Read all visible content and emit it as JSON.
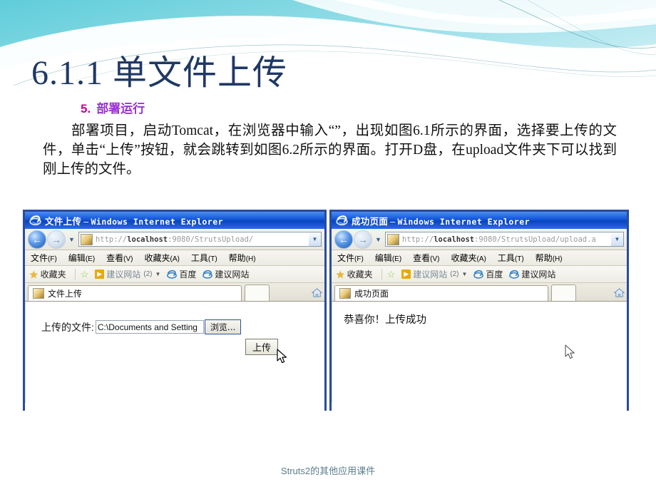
{
  "slide": {
    "title": "6.1.1  单文件上传",
    "sub_heading_number": "5.",
    "sub_heading_text": "部署运行",
    "body_paragraph": "部署项目，启动Tomcat，在浏览器中输入“”，出现如图6.1所示的界面，选择要上传的文件，单击“上传”按钮，就会跳转到如图6.2所示的界面。打开D盘，在upload文件夹下可以找到刚上传的文件。",
    "footer": "Struts2的其他应用课件"
  },
  "theme": {
    "banner_top_color": "#7fd7e0",
    "banner_bottom_color": "#bfe9f2",
    "title_color": "#1f3864",
    "heading_number_color": "#cc0099",
    "heading_text_color": "#9933cc",
    "footer_color": "#5b7d8a",
    "window_border_color": "#2a4c9b",
    "titlebar_color": "#1255d8"
  },
  "browser_left": {
    "window_title_cn": "文件上传",
    "window_title_sep": "–",
    "window_title_en": "Windows Internet Explorer",
    "address": "http://localhost:9080/StrutsUpload/",
    "address_host": "localhost",
    "address_prefix": "http://",
    "address_suffix": ":9080/StrutsUpload/",
    "menu": [
      {
        "label": "文件",
        "mnemonic": "(F)"
      },
      {
        "label": "编辑",
        "mnemonic": "(E)"
      },
      {
        "label": "查看",
        "mnemonic": "(V)"
      },
      {
        "label": "收藏夹",
        "mnemonic": "(A)"
      },
      {
        "label": "工具",
        "mnemonic": "(T)"
      },
      {
        "label": "帮助",
        "mnemonic": "(H)"
      }
    ],
    "favorites": {
      "favorites_label": "收藏夹",
      "suggested_sites": "建议网站",
      "suggested_count": "(2)",
      "baidu": "百度",
      "suggested_sites_2": "建议网站"
    },
    "tab_label": "文件上传",
    "page": {
      "form_label": "上传的文件:",
      "file_value": "C:\\Documents and Setting",
      "browse_button": "浏览...",
      "submit_button": "上传"
    }
  },
  "browser_right": {
    "window_title_cn": "成功页面",
    "window_title_sep": "–",
    "window_title_en": "Windows Internet Explorer",
    "address": "http://localhost:9080/StrutsUpload/upload.a",
    "address_host": "localhost",
    "address_prefix": "http://",
    "address_suffix": ":9080/StrutsUpload/upload.a",
    "menu": [
      {
        "label": "文件",
        "mnemonic": "(F)"
      },
      {
        "label": "编辑",
        "mnemonic": "(E)"
      },
      {
        "label": "查看",
        "mnemonic": "(V)"
      },
      {
        "label": "收藏夹",
        "mnemonic": "(A)"
      },
      {
        "label": "工具",
        "mnemonic": "(T)"
      },
      {
        "label": "帮助",
        "mnemonic": "(H)"
      }
    ],
    "favorites": {
      "favorites_label": "收藏夹",
      "suggested_sites": "建议网站",
      "suggested_count": "(2)",
      "baidu": "百度",
      "suggested_sites_2": "建议网站"
    },
    "tab_label": "成功页面",
    "page": {
      "message": "恭喜你！上传成功"
    }
  }
}
